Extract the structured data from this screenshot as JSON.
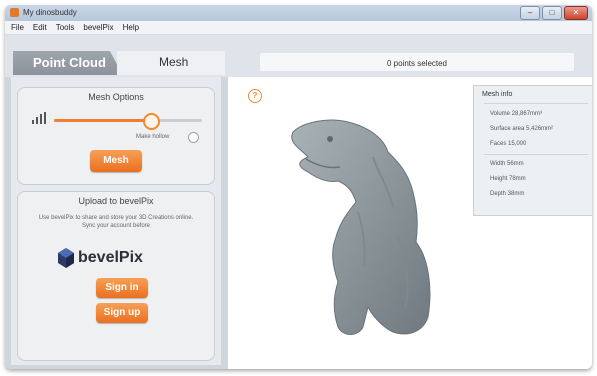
{
  "window": {
    "title": "My dinosbuddy"
  },
  "menu": [
    "File",
    "Edit",
    "Tools",
    "bevelPix",
    "Help"
  ],
  "window_controls": {
    "minimize": "–",
    "maximize": "□",
    "close": "✕"
  },
  "tabs": {
    "point_cloud": "Point Cloud",
    "mesh": "Mesh"
  },
  "status": {
    "selection": "0 points selected"
  },
  "mesh_options": {
    "title": "Mesh Options",
    "slider_level": 0.65,
    "checkbox_label": "Make hollow",
    "button": "Mesh"
  },
  "upload": {
    "title": "Upload to bevelPix",
    "description": "Use bevelPix to share and store your 3D Creations online. Sync your account before",
    "logo_text": "bevelPix",
    "sign_in": "Sign in",
    "sign_up": "Sign up"
  },
  "viewport": {
    "help_glyph": "?"
  },
  "metrics": {
    "header": "Mesh info",
    "volume": "Volume 28,867mm³",
    "surface": "Surface area 5,426mm²",
    "faces": "Faces 15,000",
    "width": "Width 56mm",
    "height": "Height 78mm",
    "depth": "Depth 38mm"
  },
  "colors": {
    "accent": "#ef7f2f",
    "model": "#8c969c",
    "panel": "#eef0f2"
  }
}
